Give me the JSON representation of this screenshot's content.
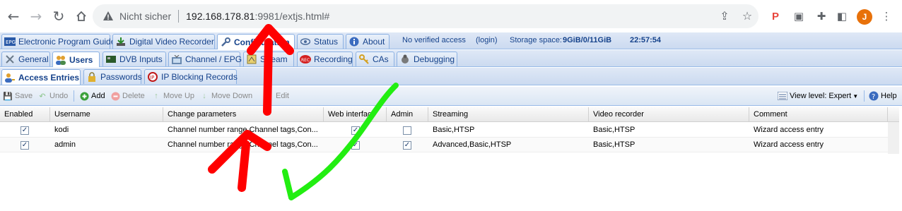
{
  "browser": {
    "insecure_label": "Nicht sicher",
    "url_host": "192.168.178.81",
    "url_rest": ":9981/extjs.html#",
    "avatar_letter": "J"
  },
  "main_tabs": [
    {
      "label": "Electronic Program Guide"
    },
    {
      "label": "Digital Video Recorder"
    },
    {
      "label": "Configuration"
    },
    {
      "label": "Status"
    },
    {
      "label": "About"
    }
  ],
  "status": {
    "access": "No verified access",
    "login": "(login)",
    "storage_label": "Storage space:",
    "storage_value": "9GiB/0/11GiB",
    "time": "22:57:54"
  },
  "config_tabs": [
    {
      "label": "General"
    },
    {
      "label": "Users"
    },
    {
      "label": "DVB Inputs"
    },
    {
      "label": "Channel / EPG"
    },
    {
      "label": "Stream"
    },
    {
      "label": "Recording"
    },
    {
      "label": "CAs"
    },
    {
      "label": "Debugging"
    }
  ],
  "user_tabs": [
    {
      "label": "Access Entries"
    },
    {
      "label": "Passwords"
    },
    {
      "label": "IP Blocking Records"
    }
  ],
  "toolbar": {
    "save": "Save",
    "undo": "Undo",
    "add": "Add",
    "delete": "Delete",
    "move_up": "Move Up",
    "move_down": "Move Down",
    "edit": "Edit",
    "view_level": "View level: Expert",
    "help": "Help"
  },
  "grid": {
    "columns": [
      "Enabled",
      "Username",
      "Change parameters",
      "Web interface",
      "Admin",
      "Streaming",
      "Video recorder",
      "Comment"
    ],
    "rows": [
      {
        "enabled": true,
        "username": "kodi",
        "change": "Channel number range,Channel tags,Con...",
        "web": true,
        "admin": false,
        "streaming": "Basic,HTSP",
        "recorder": "Basic,HTSP",
        "comment": "Wizard access entry"
      },
      {
        "enabled": true,
        "username": "admin",
        "change": "Channel number range,Channel tags,Con...",
        "web": true,
        "admin": true,
        "streaming": "Advanced,Basic,HTSP",
        "recorder": "Basic,HTSP",
        "comment": "Wizard access entry"
      }
    ]
  },
  "annotation_colors": {
    "red": "#ff0000",
    "green": "#22ee11"
  }
}
